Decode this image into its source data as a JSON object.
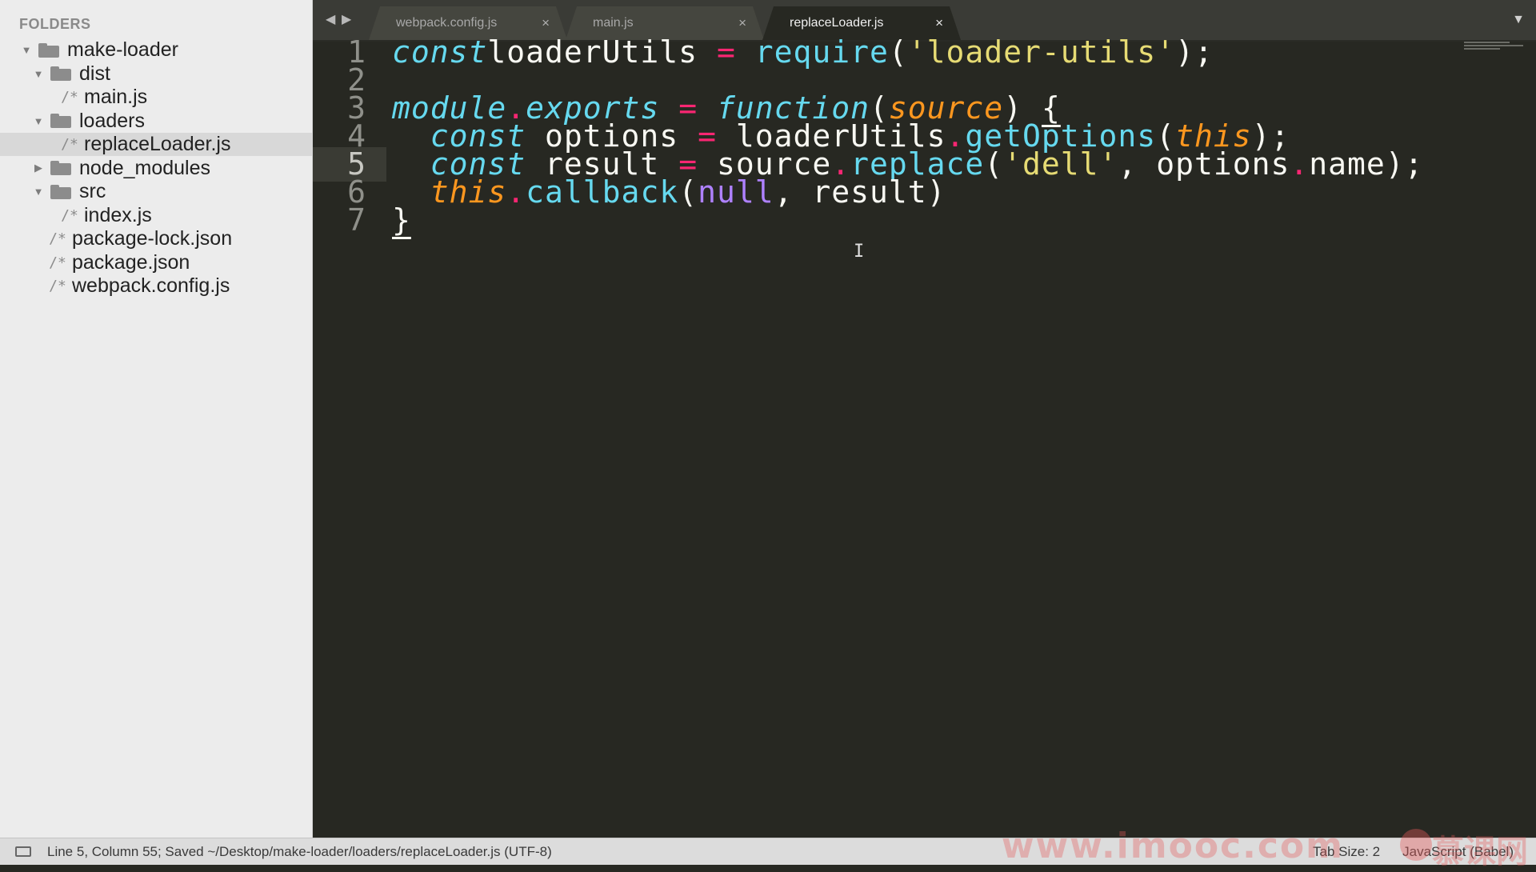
{
  "sidebar": {
    "title": "FOLDERS",
    "tree": [
      {
        "label": "make-loader",
        "kind": "folder",
        "depth": 0,
        "expanded": true
      },
      {
        "label": "dist",
        "kind": "folder",
        "depth": 1,
        "expanded": true
      },
      {
        "label": "main.js",
        "kind": "file",
        "depth": 2
      },
      {
        "label": "loaders",
        "kind": "folder",
        "depth": 1,
        "expanded": true
      },
      {
        "label": "replaceLoader.js",
        "kind": "file",
        "depth": 2,
        "selected": true
      },
      {
        "label": "node_modules",
        "kind": "folder",
        "depth": 1,
        "expanded": false
      },
      {
        "label": "src",
        "kind": "folder",
        "depth": 1,
        "expanded": true
      },
      {
        "label": "index.js",
        "kind": "file",
        "depth": 2
      },
      {
        "label": "package-lock.json",
        "kind": "file",
        "depth": 1
      },
      {
        "label": "package.json",
        "kind": "file",
        "depth": 1
      },
      {
        "label": "webpack.config.js",
        "kind": "file",
        "depth": 1
      }
    ],
    "file_icon_glyph": "/*",
    "icons": {
      "folder": "folder-icon",
      "file": "file-icon",
      "expanded": "disclosure-open-icon",
      "collapsed": "disclosure-closed-icon"
    }
  },
  "tabs": {
    "nav_back": "◀",
    "nav_forward": "▶",
    "items": [
      {
        "label": "webpack.config.js",
        "active": false
      },
      {
        "label": "main.js",
        "active": false
      },
      {
        "label": "replaceLoader.js",
        "active": true
      }
    ],
    "close_glyph": "×",
    "overflow_glyph": "▼"
  },
  "editor": {
    "current_line": 5,
    "lines": [
      {
        "n": "1",
        "tokens": [
          [
            "k",
            "const"
          ],
          [
            "",
            "loaderUtils "
          ],
          [
            "op",
            "="
          ],
          [
            "",
            " "
          ],
          [
            "fn",
            "require"
          ],
          [
            "",
            "("
          ],
          [
            "str",
            "'loader-utils'"
          ],
          [
            "",
            ");"
          ]
        ]
      },
      {
        "n": "2",
        "tokens": []
      },
      {
        "n": "3",
        "tokens": [
          [
            "k",
            "module"
          ],
          [
            "op",
            "."
          ],
          [
            "k",
            "exports"
          ],
          [
            "",
            " "
          ],
          [
            "op",
            "="
          ],
          [
            "",
            " "
          ],
          [
            "k",
            "function"
          ],
          [
            "",
            "("
          ],
          [
            "prm",
            "source"
          ],
          [
            "",
            ") "
          ],
          [
            "brace",
            "{"
          ]
        ]
      },
      {
        "n": "4",
        "tokens": [
          [
            "",
            "  "
          ],
          [
            "k",
            "const"
          ],
          [
            "",
            " options "
          ],
          [
            "op",
            "="
          ],
          [
            "",
            " loaderUtils"
          ],
          [
            "op",
            "."
          ],
          [
            "fn",
            "getOptions"
          ],
          [
            "",
            "("
          ],
          [
            "ths",
            "this"
          ],
          [
            "",
            ");"
          ]
        ]
      },
      {
        "n": "5",
        "tokens": [
          [
            "",
            "  "
          ],
          [
            "k",
            "const"
          ],
          [
            "",
            " result "
          ],
          [
            "op",
            "="
          ],
          [
            "",
            " source"
          ],
          [
            "op",
            "."
          ],
          [
            "fn",
            "replace"
          ],
          [
            "",
            "("
          ],
          [
            "str",
            "'dell'"
          ],
          [
            "",
            ", options"
          ],
          [
            "op",
            "."
          ],
          [
            "",
            "name);"
          ]
        ]
      },
      {
        "n": "6",
        "tokens": [
          [
            "",
            "  "
          ],
          [
            "ths",
            "this"
          ],
          [
            "op",
            "."
          ],
          [
            "fn",
            "callback"
          ],
          [
            "",
            "("
          ],
          [
            "nul",
            "null"
          ],
          [
            "",
            ", result)"
          ]
        ]
      },
      {
        "n": "7",
        "tokens": [
          [
            "brace",
            "}"
          ]
        ]
      }
    ],
    "colors": {
      "background": "#272822",
      "keyword": "#66d9ef",
      "operator": "#f92672",
      "string": "#e6db74",
      "param": "#fd971f",
      "constant": "#ae81ff",
      "text": "#f8f8f2"
    }
  },
  "statusbar": {
    "message": "Line 5, Column 55; Saved ~/Desktop/make-loader/loaders/replaceLoader.js (UTF-8)",
    "indent": "Tab Size: 2",
    "syntax": "JavaScript (Babel)",
    "watermark": "www.imooc.com",
    "brand": "慕课网"
  }
}
